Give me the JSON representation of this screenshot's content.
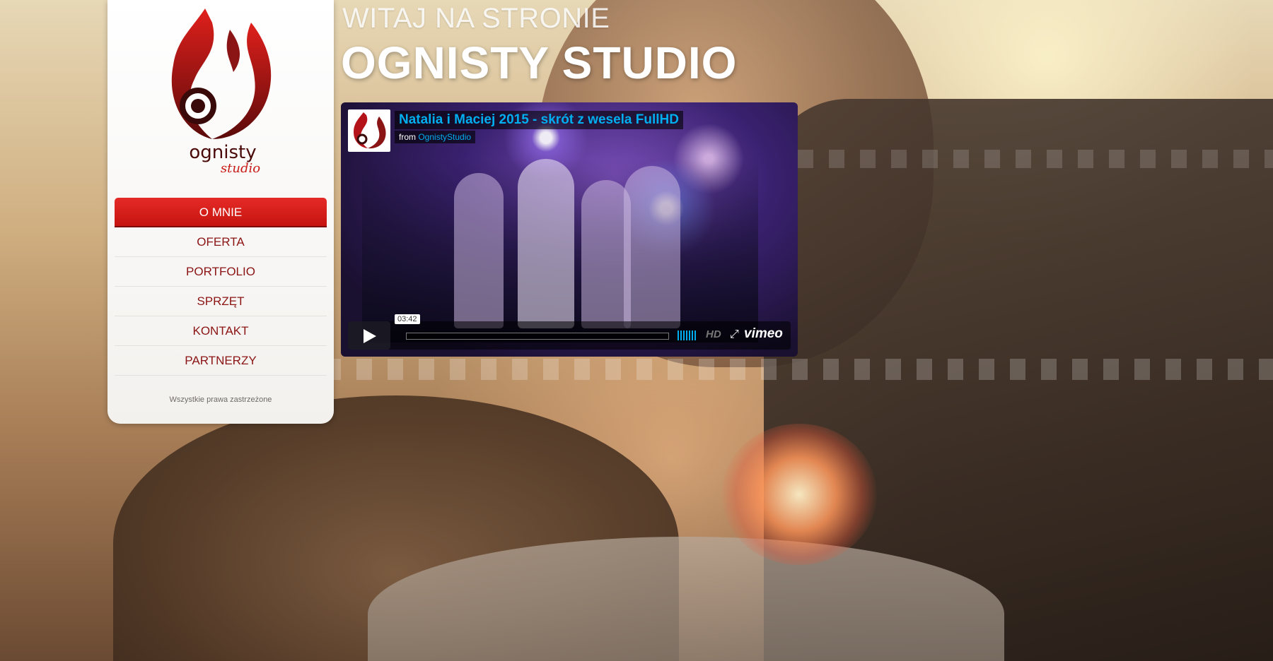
{
  "heading": {
    "welcome": "WITAJ NA STRONIE",
    "studio": "OGNISTY STUDIO"
  },
  "logo": {
    "line1": "ognisty",
    "line2": "studio"
  },
  "nav": {
    "items": [
      {
        "label": "O MNIE",
        "active": true
      },
      {
        "label": "OFERTA"
      },
      {
        "label": "PORTFOLIO"
      },
      {
        "label": "SPRZĘT"
      },
      {
        "label": "KONTAKT"
      },
      {
        "label": "PARTNERZY"
      }
    ]
  },
  "footer": {
    "copyright": "Wszystkie prawa zastrzeżone"
  },
  "video": {
    "title": "Natalia i Maciej 2015 - skrót z wesela FullHD",
    "from_label": "from",
    "author": "OgnistyStudio",
    "duration": "03:42",
    "hd_label": "HD",
    "brand": "vimeo",
    "colors": {
      "accent": "#00adef"
    }
  },
  "colors": {
    "nav_active": "#d81e1a",
    "nav_text": "#8b1414"
  }
}
